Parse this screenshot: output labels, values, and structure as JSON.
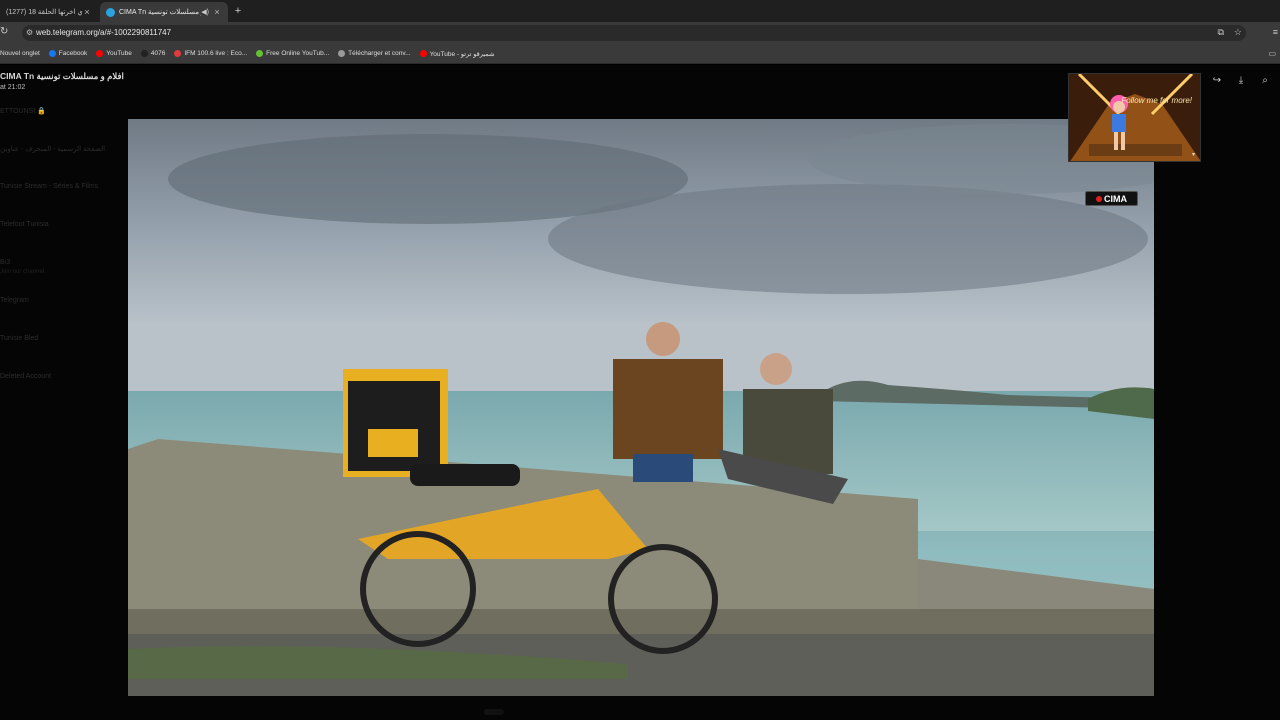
{
  "tabs": [
    {
      "title": "(1277) هادي اخرتها الحلقة 18 -",
      "active": false
    },
    {
      "title": "CIMA Tn افلام و مسلسلات تونسية",
      "active": true
    }
  ],
  "address": {
    "url": "web.telegram.org/a/#-1002290811747"
  },
  "bookmarks": [
    {
      "label": "Nouvel onglet",
      "icon_color": ""
    },
    {
      "label": "Facebook",
      "icon_color": "#1877f2"
    },
    {
      "label": "YouTube",
      "icon_color": "#ff0000"
    },
    {
      "label": "4076",
      "icon_color": "#222222"
    },
    {
      "label": "IFM 100.6 live : Eco...",
      "icon_color": "#e33b3b"
    },
    {
      "label": "Free Online YouTub...",
      "icon_color": "#63c132"
    },
    {
      "label": "Télécharger et conv...",
      "icon_color": "#9a9a9a"
    },
    {
      "label": "YouTube - شميرقو ترتو",
      "icon_color": "#ff0000"
    }
  ],
  "chat": {
    "title": "CIMA Tn افلام و مسلسلات تونسية",
    "subtitle": "at 21:02"
  },
  "ghost_chats": [
    {
      "name": "ETTOUNSI 🔒",
      "preview": ""
    },
    {
      "name": "الصفحة الرسمية - المنحرف - عناوين",
      "preview": ""
    },
    {
      "name": "Tunisie Stream - Séries & Films",
      "preview": ""
    },
    {
      "name": "Telefoot Tunisia",
      "preview": ""
    },
    {
      "name": "Bi3",
      "preview": "Join our channel"
    },
    {
      "name": "Telegram",
      "preview": ""
    },
    {
      "name": "Tunisie Bled",
      "preview": ""
    },
    {
      "name": "Deleted Account",
      "preview": ""
    }
  ],
  "viewer": {
    "badge": "CIMA",
    "ad_text": "Follow me for more!"
  },
  "icons": {
    "share": "share-icon",
    "download": "download-icon",
    "zoom": "zoom-icon"
  }
}
